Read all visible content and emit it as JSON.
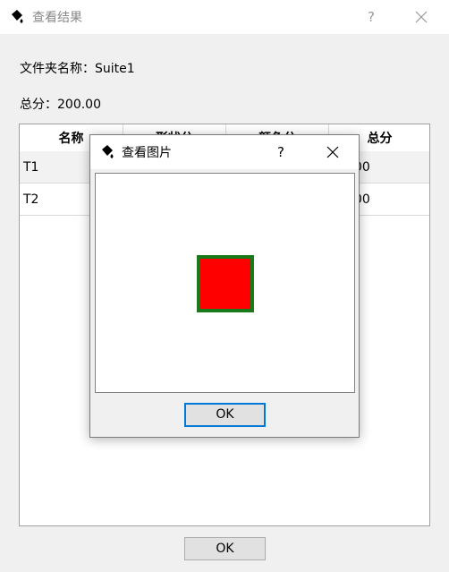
{
  "main_window": {
    "title": "查看结果",
    "help": "?",
    "folder_label": "文件夹名称：Suite1",
    "total_label": "总分：200.00",
    "table": {
      "headers": [
        "名称",
        "形状分",
        "颜色分",
        "总分"
      ],
      "rows": [
        {
          "name": "T1",
          "shape": "",
          "color": "",
          "total": "00"
        },
        {
          "name": "T2",
          "shape": "",
          "color": "",
          "total": "00"
        }
      ]
    },
    "ok_label": "OK"
  },
  "dialog": {
    "title": "查看图片",
    "help": "?",
    "ok_label": "OK",
    "image": {
      "fill_color": "#ff0000",
      "border_color": "#1a7a1a"
    }
  }
}
